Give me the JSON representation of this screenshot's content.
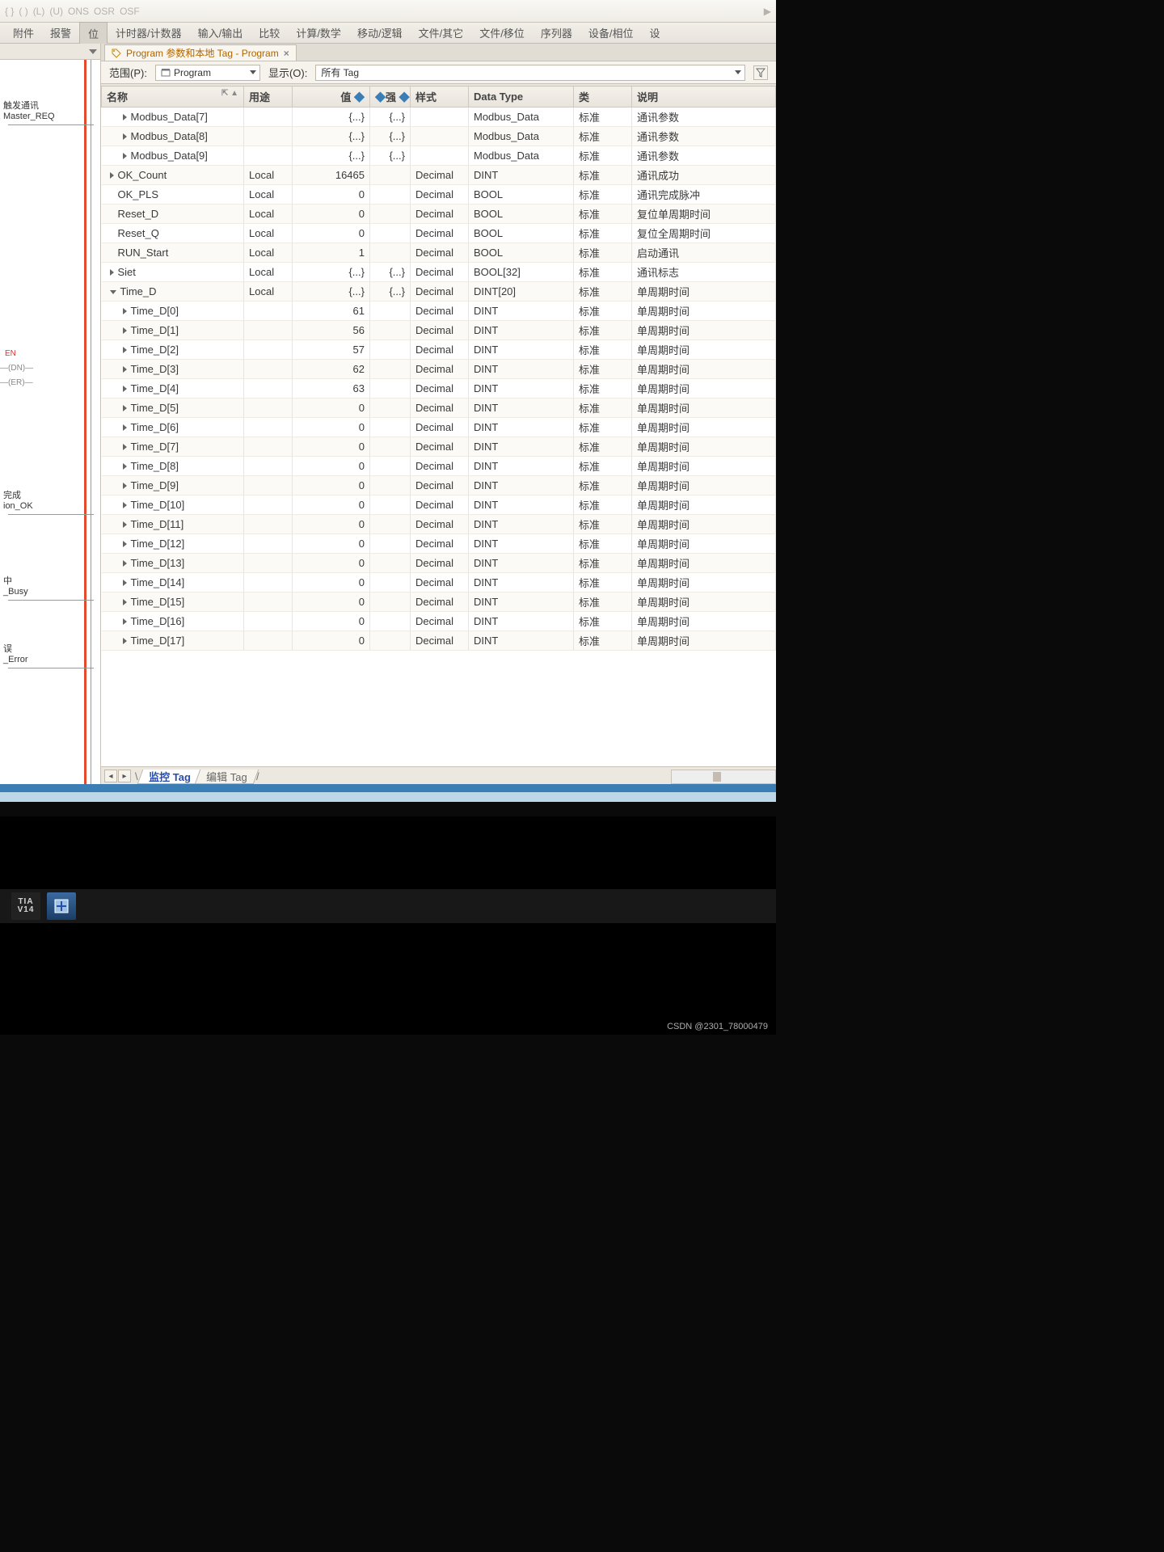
{
  "icon_toolbar": [
    "{ }",
    "( )",
    "(L)",
    "(U)",
    "ONS",
    "OSR",
    "OSF"
  ],
  "menu": {
    "items": [
      "附件",
      "报警",
      "位",
      "计时器/计数器",
      "输入/输出",
      "比较",
      "计算/数学",
      "移动/逻辑",
      "文件/其它",
      "文件/移位",
      "序列器",
      "设备/相位",
      "设"
    ],
    "active_index": 2
  },
  "left_dock": {
    "labels": {
      "trigger": "触发通讯",
      "master_req": "Master_REQ",
      "en": "EN",
      "dn": "DN",
      "er": "ER",
      "done": "完成",
      "ion_ok": "ion_OK",
      "zhong": "中",
      "busy": "_Busy",
      "wu": "误",
      "error": "_Error"
    }
  },
  "editor_tab": {
    "title": "Program 参数和本地 Tag - Program",
    "close": "×"
  },
  "filter": {
    "scope_label": "范围(P):",
    "scope_value": "Program",
    "show_label": "显示(O):",
    "show_value": "所有 Tag"
  },
  "columns": {
    "name": "名称",
    "usage": "用途",
    "value": "值",
    "force": "强",
    "style": "样式",
    "datatype": "Data Type",
    "class": "类",
    "desc": "说明"
  },
  "class_std": "标准",
  "rows": [
    {
      "i": 1,
      "tw": 1,
      "name": "Modbus_Data[7]",
      "usage": "",
      "value": "{...}",
      "force": "{...}",
      "style": "",
      "datatype": "Modbus_Data",
      "desc": "通讯参数"
    },
    {
      "i": 1,
      "tw": 1,
      "name": "Modbus_Data[8]",
      "usage": "",
      "value": "{...}",
      "force": "{...}",
      "style": "",
      "datatype": "Modbus_Data",
      "desc": "通讯参数"
    },
    {
      "i": 1,
      "tw": 1,
      "name": "Modbus_Data[9]",
      "usage": "",
      "value": "{...}",
      "force": "{...}",
      "style": "",
      "datatype": "Modbus_Data",
      "desc": "通讯参数"
    },
    {
      "i": 0,
      "tw": 1,
      "name": "OK_Count",
      "usage": "Local",
      "value": "16465",
      "force": "",
      "style": "Decimal",
      "datatype": "DINT",
      "desc": "通讯成功"
    },
    {
      "i": 0,
      "tw": 0,
      "name": "OK_PLS",
      "usage": "Local",
      "value": "0",
      "force": "",
      "style": "Decimal",
      "datatype": "BOOL",
      "desc": "通讯完成脉冲"
    },
    {
      "i": 0,
      "tw": 0,
      "name": "Reset_D",
      "usage": "Local",
      "value": "0",
      "force": "",
      "style": "Decimal",
      "datatype": "BOOL",
      "desc": "复位单周期时间"
    },
    {
      "i": 0,
      "tw": 0,
      "name": "Reset_Q",
      "usage": "Local",
      "value": "0",
      "force": "",
      "style": "Decimal",
      "datatype": "BOOL",
      "desc": "复位全周期时间"
    },
    {
      "i": 0,
      "tw": 0,
      "name": "RUN_Start",
      "usage": "Local",
      "value": "1",
      "force": "",
      "style": "Decimal",
      "datatype": "BOOL",
      "desc": "启动通讯"
    },
    {
      "i": 0,
      "tw": 1,
      "name": "Siet",
      "usage": "Local",
      "value": "{...}",
      "force": "{...}",
      "style": "Decimal",
      "datatype": "BOOL[32]",
      "desc": "通讯标志"
    },
    {
      "i": 0,
      "tw": 2,
      "name": "Time_D",
      "usage": "Local",
      "value": "{...}",
      "force": "{...}",
      "style": "Decimal",
      "datatype": "DINT[20]",
      "desc": "单周期时间"
    },
    {
      "i": 1,
      "tw": 1,
      "name": "Time_D[0]",
      "usage": "",
      "value": "61",
      "force": "",
      "style": "Decimal",
      "datatype": "DINT",
      "desc": "单周期时间"
    },
    {
      "i": 1,
      "tw": 1,
      "name": "Time_D[1]",
      "usage": "",
      "value": "56",
      "force": "",
      "style": "Decimal",
      "datatype": "DINT",
      "desc": "单周期时间"
    },
    {
      "i": 1,
      "tw": 1,
      "name": "Time_D[2]",
      "usage": "",
      "value": "57",
      "force": "",
      "style": "Decimal",
      "datatype": "DINT",
      "desc": "单周期时间"
    },
    {
      "i": 1,
      "tw": 1,
      "name": "Time_D[3]",
      "usage": "",
      "value": "62",
      "force": "",
      "style": "Decimal",
      "datatype": "DINT",
      "desc": "单周期时间"
    },
    {
      "i": 1,
      "tw": 1,
      "name": "Time_D[4]",
      "usage": "",
      "value": "63",
      "force": "",
      "style": "Decimal",
      "datatype": "DINT",
      "desc": "单周期时间"
    },
    {
      "i": 1,
      "tw": 1,
      "name": "Time_D[5]",
      "usage": "",
      "value": "0",
      "force": "",
      "style": "Decimal",
      "datatype": "DINT",
      "desc": "单周期时间"
    },
    {
      "i": 1,
      "tw": 1,
      "name": "Time_D[6]",
      "usage": "",
      "value": "0",
      "force": "",
      "style": "Decimal",
      "datatype": "DINT",
      "desc": "单周期时间"
    },
    {
      "i": 1,
      "tw": 1,
      "name": "Time_D[7]",
      "usage": "",
      "value": "0",
      "force": "",
      "style": "Decimal",
      "datatype": "DINT",
      "desc": "单周期时间"
    },
    {
      "i": 1,
      "tw": 1,
      "name": "Time_D[8]",
      "usage": "",
      "value": "0",
      "force": "",
      "style": "Decimal",
      "datatype": "DINT",
      "desc": "单周期时间"
    },
    {
      "i": 1,
      "tw": 1,
      "name": "Time_D[9]",
      "usage": "",
      "value": "0",
      "force": "",
      "style": "Decimal",
      "datatype": "DINT",
      "desc": "单周期时间"
    },
    {
      "i": 1,
      "tw": 1,
      "name": "Time_D[10]",
      "usage": "",
      "value": "0",
      "force": "",
      "style": "Decimal",
      "datatype": "DINT",
      "desc": "单周期时间"
    },
    {
      "i": 1,
      "tw": 1,
      "name": "Time_D[11]",
      "usage": "",
      "value": "0",
      "force": "",
      "style": "Decimal",
      "datatype": "DINT",
      "desc": "单周期时间"
    },
    {
      "i": 1,
      "tw": 1,
      "name": "Time_D[12]",
      "usage": "",
      "value": "0",
      "force": "",
      "style": "Decimal",
      "datatype": "DINT",
      "desc": "单周期时间"
    },
    {
      "i": 1,
      "tw": 1,
      "name": "Time_D[13]",
      "usage": "",
      "value": "0",
      "force": "",
      "style": "Decimal",
      "datatype": "DINT",
      "desc": "单周期时间"
    },
    {
      "i": 1,
      "tw": 1,
      "name": "Time_D[14]",
      "usage": "",
      "value": "0",
      "force": "",
      "style": "Decimal",
      "datatype": "DINT",
      "desc": "单周期时间"
    },
    {
      "i": 1,
      "tw": 1,
      "name": "Time_D[15]",
      "usage": "",
      "value": "0",
      "force": "",
      "style": "Decimal",
      "datatype": "DINT",
      "desc": "单周期时间"
    },
    {
      "i": 1,
      "tw": 1,
      "name": "Time_D[16]",
      "usage": "",
      "value": "0",
      "force": "",
      "style": "Decimal",
      "datatype": "DINT",
      "desc": "单周期时间"
    },
    {
      "i": 1,
      "tw": 1,
      "name": "Time_D[17]",
      "usage": "",
      "value": "0",
      "force": "",
      "style": "Decimal",
      "datatype": "DINT",
      "desc": "单周期时间"
    }
  ],
  "bottom_tabs": {
    "monitor": "监控 Tag",
    "edit": "编辑 Tag"
  },
  "taskbar": {
    "tia": "TIA\nV14"
  },
  "watermark": "CSDN @2301_78000479"
}
